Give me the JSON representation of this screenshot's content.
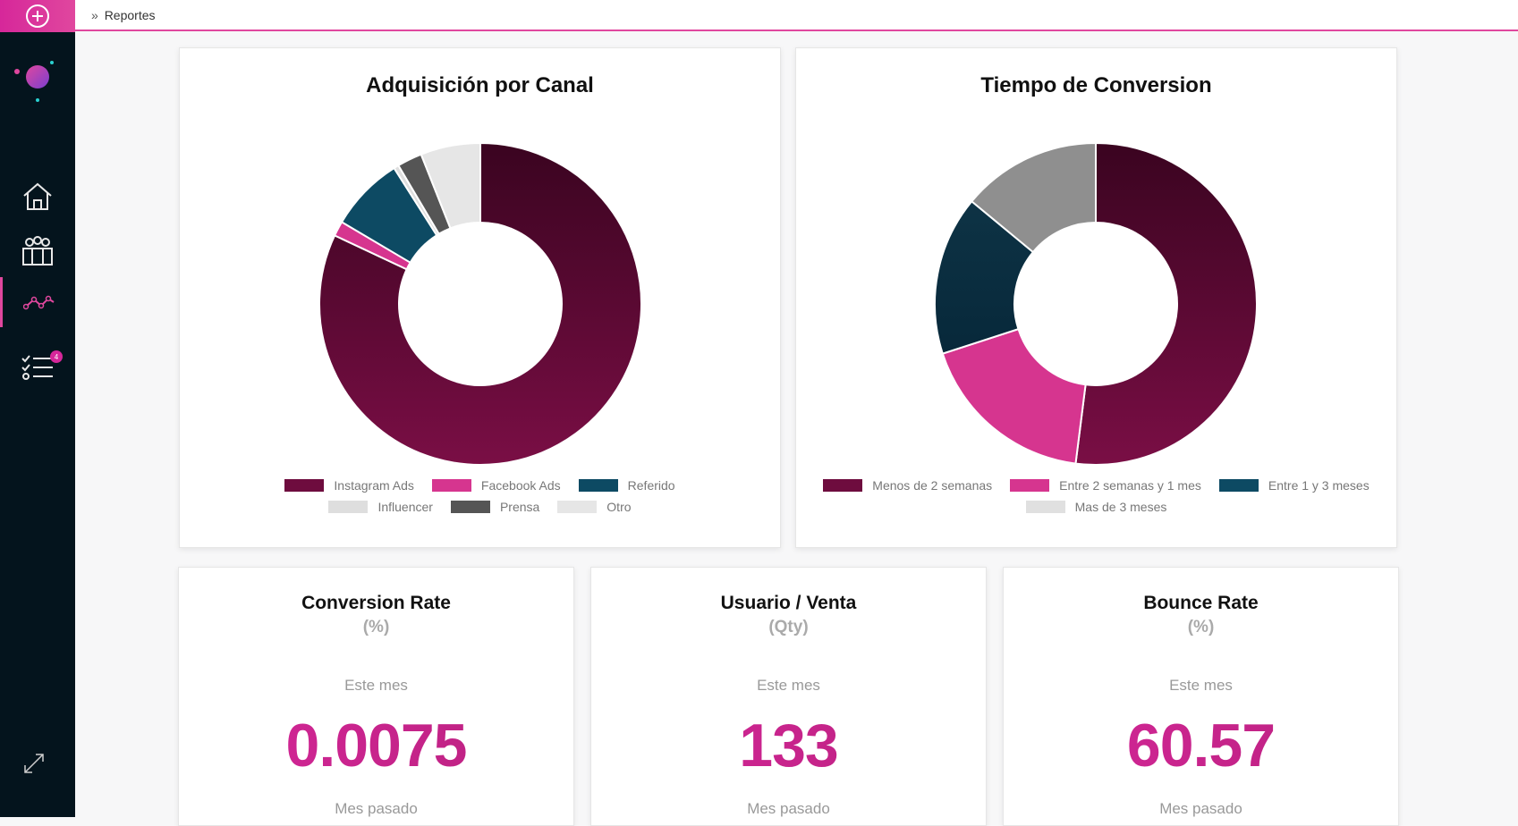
{
  "breadcrumb": {
    "separator": "»",
    "label": "Reportes"
  },
  "sidebar": {
    "items": [
      {
        "name": "home"
      },
      {
        "name": "users"
      },
      {
        "name": "reports"
      },
      {
        "name": "tasks",
        "badge": "4"
      }
    ]
  },
  "colors": {
    "accent": "#e0479e",
    "sidebar_bg": "#04141d"
  },
  "charts": {
    "channel": {
      "title": "Adquisición por Canal"
    },
    "conversion_time": {
      "title": "Tiempo de Conversion"
    }
  },
  "chart_data": [
    {
      "type": "pie",
      "title": "Adquisición por Canal",
      "legend_position": "bottom",
      "categories": [
        "Instagram Ads",
        "Facebook Ads",
        "Referido",
        "Influencer",
        "Prensa",
        "Otro"
      ],
      "values": [
        82,
        1.5,
        7.5,
        0.5,
        2.5,
        6
      ],
      "colors": [
        "#6e0c3e",
        "#d6358f",
        "#0d4a63",
        "#dedede",
        "#555555",
        "#e6e6e6"
      ],
      "gradient_first": [
        "#3a0420",
        "#7a0e45"
      ]
    },
    {
      "type": "pie",
      "title": "Tiempo de Conversion",
      "legend_position": "bottom",
      "categories": [
        "Menos de 2 semanas",
        "Entre 2 semanas y 1 mes",
        "Entre 1 y 3 meses",
        "Mas de 3 meses"
      ],
      "values": [
        52,
        18,
        16,
        14
      ],
      "colors": [
        "#6e0c3e",
        "#d6358f",
        "#0d3447",
        "#8f8f8f"
      ],
      "legend_colors": [
        "#6e0c3e",
        "#d6358f",
        "#0d4a63",
        "#e0e0e0"
      ]
    }
  ],
  "stats": [
    {
      "title": "Conversion Rate",
      "unit": "(%)",
      "this_month_label": "Este mes",
      "value": "0.0075",
      "last_month_label": "Mes pasado"
    },
    {
      "title": "Usuario / Venta",
      "unit": "(Qty)",
      "this_month_label": "Este mes",
      "value": "133",
      "last_month_label": "Mes pasado"
    },
    {
      "title": "Bounce Rate",
      "unit": "(%)",
      "this_month_label": "Este mes",
      "value": "60.57",
      "last_month_label": "Mes pasado"
    }
  ]
}
